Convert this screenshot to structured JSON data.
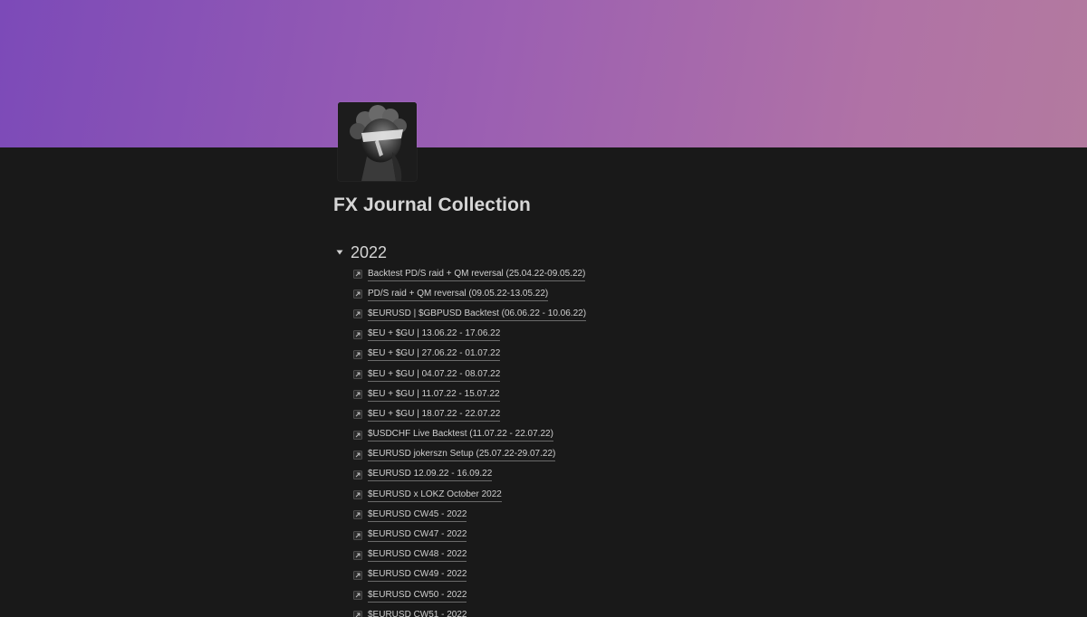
{
  "page": {
    "title": "FX Journal Collection",
    "icon": "statue-head-image",
    "cover_colors": [
      "#7c4ab8",
      "#b37a9f"
    ]
  },
  "toggle": {
    "label": "2022",
    "icon": "triangle-down-icon",
    "expanded": true
  },
  "items": [
    {
      "label": "Backtest PD/S raid + QM reversal (25.04.22-09.05.22)",
      "icon": "page-link-icon"
    },
    {
      "label": "PD/S raid + QM reversal (09.05.22-13.05.22)",
      "icon": "page-link-icon"
    },
    {
      "label": "$EURUSD | $GBPUSD Backtest (06.06.22 - 10.06.22)",
      "icon": "page-link-icon"
    },
    {
      "label": "$EU + $GU | 13.06.22 - 17.06.22",
      "icon": "page-link-icon"
    },
    {
      "label": "$EU + $GU | 27.06.22 - 01.07.22",
      "icon": "page-link-icon"
    },
    {
      "label": "$EU + $GU | 04.07.22 - 08.07.22",
      "icon": "page-link-icon"
    },
    {
      "label": "$EU + $GU | 11.07.22 - 15.07.22",
      "icon": "page-link-icon"
    },
    {
      "label": "$EU + $GU | 18.07.22 - 22.07.22",
      "icon": "page-link-icon"
    },
    {
      "label": "$USDCHF Live Backtest (11.07.22 - 22.07.22)",
      "icon": "page-link-icon"
    },
    {
      "label": "$EURUSD jokerszn Setup (25.07.22-29.07.22)",
      "icon": "page-link-icon"
    },
    {
      "label": "$EURUSD 12.09.22 - 16.09.22",
      "icon": "page-link-icon"
    },
    {
      "label": "$EURUSD x LOKZ October 2022",
      "icon": "page-link-icon"
    },
    {
      "label": "$EURUSD CW45 - 2022",
      "icon": "page-link-icon"
    },
    {
      "label": "$EURUSD CW47 - 2022",
      "icon": "page-link-icon"
    },
    {
      "label": "$EURUSD CW48 - 2022",
      "icon": "page-link-icon"
    },
    {
      "label": "$EURUSD CW49 - 2022",
      "icon": "page-link-icon"
    },
    {
      "label": "$EURUSD CW50 - 2022",
      "icon": "page-link-icon"
    },
    {
      "label": "$EURUSD CW51 - 2022",
      "icon": "page-link-icon"
    }
  ]
}
